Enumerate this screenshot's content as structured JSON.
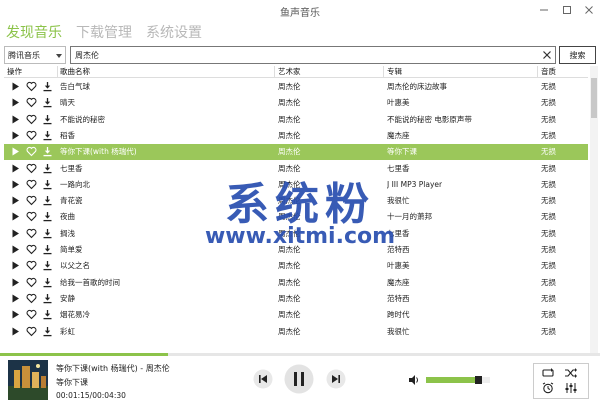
{
  "window": {
    "title": "鱼声音乐"
  },
  "nav": {
    "tabs": [
      {
        "label": "发现音乐",
        "active": true
      },
      {
        "label": "下载管理",
        "active": false
      },
      {
        "label": "系统设置",
        "active": false
      }
    ]
  },
  "search": {
    "source": "腾讯音乐",
    "query": "周杰伦",
    "button_label": "搜索"
  },
  "table": {
    "headers": [
      "操作",
      "歌曲名称",
      "艺术家",
      "专辑",
      "音质"
    ],
    "rows": [
      {
        "song": "告白气球",
        "artist": "周杰伦",
        "album": "周杰伦的床边故事",
        "quality": "无损",
        "selected": false
      },
      {
        "song": "晴天",
        "artist": "周杰伦",
        "album": "叶惠美",
        "quality": "无损",
        "selected": false
      },
      {
        "song": "不能说的秘密",
        "artist": "周杰伦",
        "album": "不能说的秘密 电影原声带",
        "quality": "无损",
        "selected": false
      },
      {
        "song": "稻香",
        "artist": "周杰伦",
        "album": "魔杰座",
        "quality": "无损",
        "selected": false
      },
      {
        "song": "等你下课(with 杨瑞代)",
        "artist": "周杰伦",
        "album": "等你下课",
        "quality": "无损",
        "selected": true
      },
      {
        "song": "七里香",
        "artist": "周杰伦",
        "album": "七里香",
        "quality": "无损",
        "selected": false
      },
      {
        "song": "一路向北",
        "artist": "周杰伦",
        "album": "J III MP3 Player",
        "quality": "无损",
        "selected": false
      },
      {
        "song": "青花瓷",
        "artist": "周杰伦",
        "album": "我很忙",
        "quality": "无损",
        "selected": false
      },
      {
        "song": "夜曲",
        "artist": "周杰伦",
        "album": "十一月的萧邦",
        "quality": "无损",
        "selected": false
      },
      {
        "song": "搁浅",
        "artist": "周杰伦",
        "album": "七里香",
        "quality": "无损",
        "selected": false
      },
      {
        "song": "简单爱",
        "artist": "周杰伦",
        "album": "范特西",
        "quality": "无损",
        "selected": false
      },
      {
        "song": "以父之名",
        "artist": "周杰伦",
        "album": "叶惠美",
        "quality": "无损",
        "selected": false
      },
      {
        "song": "给我一首歌的时间",
        "artist": "周杰伦",
        "album": "魔杰座",
        "quality": "无损",
        "selected": false
      },
      {
        "song": "安静",
        "artist": "周杰伦",
        "album": "范特西",
        "quality": "无损",
        "selected": false
      },
      {
        "song": "烟花易冷",
        "artist": "周杰伦",
        "album": "跨时代",
        "quality": "无损",
        "selected": false
      },
      {
        "song": "彩虹",
        "artist": "周杰伦",
        "album": "我很忙",
        "quality": "无损",
        "selected": false
      }
    ]
  },
  "player": {
    "now_playing": "等你下课(with 杨瑞代) - 周杰伦",
    "album": "等你下课",
    "time": "00:01:15/00:04:30",
    "progress_fraction": 0.28,
    "volume_fraction": 0.78,
    "is_playing": true
  },
  "watermark": {
    "text": "系统粉",
    "url": "www.xitmi.com"
  },
  "colors": {
    "accent": "#8cc34a",
    "selected_row": "#9bc75a",
    "watermark": "#2a4fb0"
  },
  "icons": {
    "row_actions": [
      "play-icon",
      "heart-icon",
      "download-icon"
    ],
    "controls": [
      "prev-icon",
      "pause-icon",
      "next-icon",
      "volume-icon",
      "repeat-icon",
      "shuffle-icon",
      "alarm-icon",
      "equalizer-icon"
    ]
  }
}
